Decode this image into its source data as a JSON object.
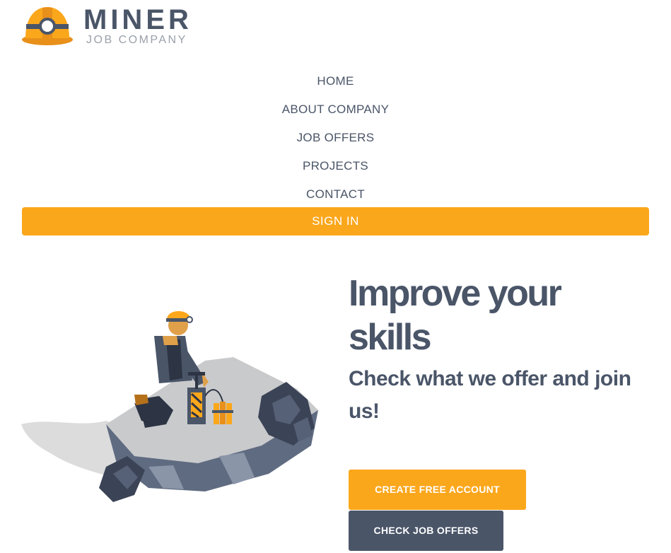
{
  "logo": {
    "title": "MINER",
    "subtitle": "JOB COMPANY",
    "icon": "miner-helmet-icon"
  },
  "nav": {
    "items": [
      {
        "label": "HOME"
      },
      {
        "label": "ABOUT COMPANY"
      },
      {
        "label": "JOB OFFERS"
      },
      {
        "label": "PROJECTS"
      },
      {
        "label": "CONTACT"
      }
    ],
    "signin_label": "SIGN IN"
  },
  "hero": {
    "title": "Improve your skills",
    "subtitle": "Check what we offer and join us!",
    "create_label": "CREATE FREE ACCOUNT",
    "check_label": "CHECK JOB OFFERS",
    "illustration": "miner-detonator-illustration"
  },
  "colors": {
    "accent": "#fba71c",
    "text": "#4a5568",
    "muted": "#9aa1ab"
  }
}
